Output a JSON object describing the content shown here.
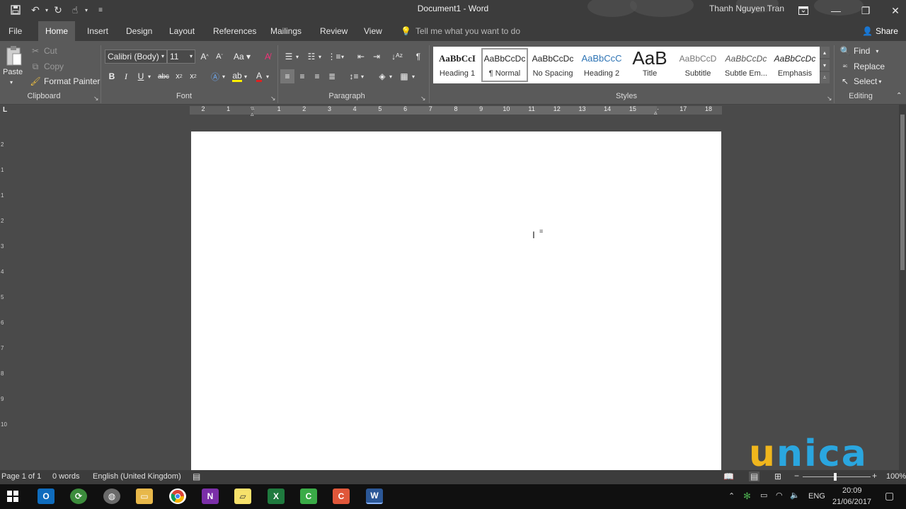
{
  "window": {
    "title": "Document1 - Word",
    "user": "Thanh Nguyen Tran"
  },
  "tabs": [
    "File",
    "Home",
    "Insert",
    "Design",
    "Layout",
    "References",
    "Mailings",
    "Review",
    "View"
  ],
  "tell_me": "Tell me what you want to do",
  "share_label": "Share",
  "clipboard": {
    "paste": "Paste",
    "cut": "Cut",
    "copy": "Copy",
    "format_painter": "Format Painter",
    "group": "Clipboard"
  },
  "font": {
    "name": "Calibri (Body)",
    "size": "11",
    "group": "Font"
  },
  "paragraph": {
    "group": "Paragraph"
  },
  "styles": {
    "group": "Styles",
    "items": [
      {
        "preview": "AaBbCcI",
        "name": "Heading 1"
      },
      {
        "preview": "AaBbCcDc",
        "name": "¶ Normal"
      },
      {
        "preview": "AaBbCcDc",
        "name": "No Spacing"
      },
      {
        "preview": "AaBbCcC",
        "name": "Heading 2"
      },
      {
        "preview": "AaB",
        "name": "Title"
      },
      {
        "preview": "AaBbCcD",
        "name": "Subtitle"
      },
      {
        "preview": "AaBbCcDc",
        "name": "Subtle Em..."
      },
      {
        "preview": "AaBbCcDc",
        "name": "Emphasis"
      }
    ]
  },
  "editing": {
    "find": "Find",
    "replace": "Replace",
    "select": "Select",
    "group": "Editing"
  },
  "ruler": {
    "marks": [
      "2",
      "1",
      "",
      "1",
      "2",
      "3",
      "4",
      "5",
      "6",
      "7",
      "8",
      "9",
      "10",
      "11",
      "12",
      "13",
      "14",
      "15",
      "",
      "17",
      "18"
    ]
  },
  "vruler": [
    "2",
    "1",
    "1",
    "2",
    "3",
    "4",
    "5",
    "6",
    "7",
    "8",
    "9",
    "10"
  ],
  "status": {
    "page": "Page 1 of 1",
    "words": "0 words",
    "language": "English (United Kingdom)",
    "zoom": "100%"
  },
  "taskbar": {
    "language": "ENG",
    "time": "20:09",
    "date": "21/06/2017"
  },
  "logo": {
    "first": "u",
    "rest": "nica"
  }
}
